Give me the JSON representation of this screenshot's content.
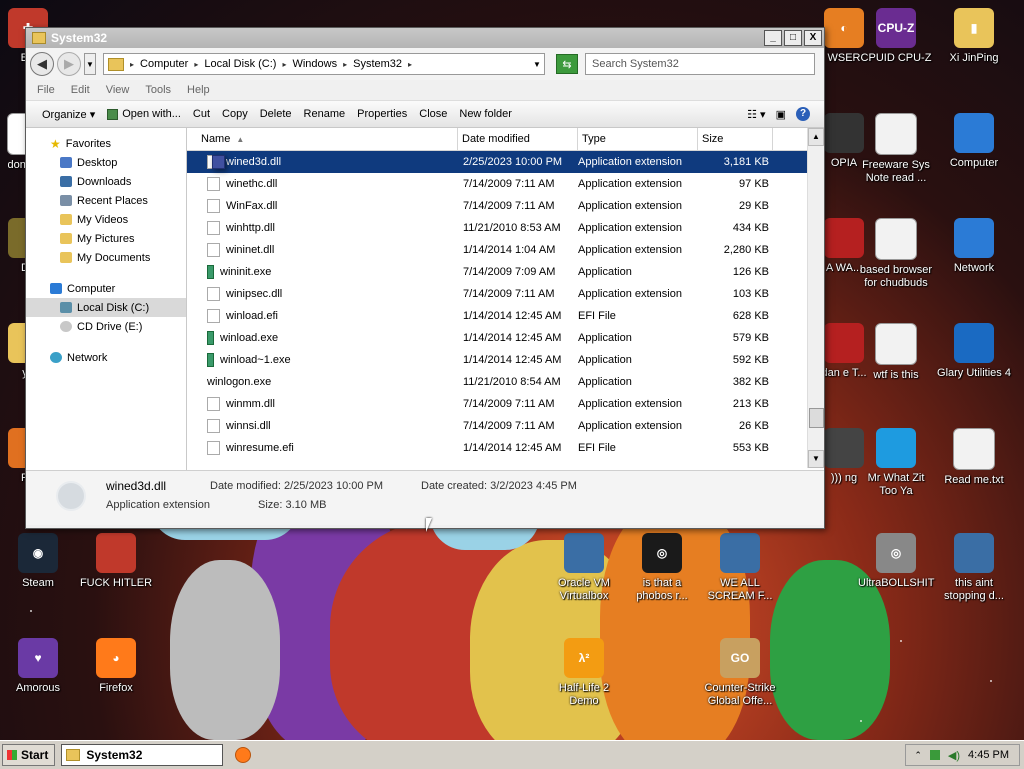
{
  "window": {
    "title": "System32",
    "controls": {
      "minimize": "_",
      "maximize": "□",
      "close": "X"
    }
  },
  "address": {
    "crumbs": [
      "Computer",
      "Local Disk (C:)",
      "Windows",
      "System32"
    ],
    "separator": "▸",
    "search_placeholder": "Search System32"
  },
  "menu": [
    "File",
    "Edit",
    "View",
    "Tools",
    "Help"
  ],
  "toolbar": {
    "organize": "Organize ▾",
    "open_with": "Open with...",
    "cut": "Cut",
    "copy": "Copy",
    "delete": "Delete",
    "rename": "Rename",
    "properties": "Properties",
    "close": "Close",
    "new_folder": "New folder",
    "help_icon": "?"
  },
  "nav": {
    "favorites_label": "Favorites",
    "favorites": [
      "Desktop",
      "Downloads",
      "Recent Places",
      "My Videos",
      "My Pictures",
      "My Documents"
    ],
    "computer_label": "Computer",
    "drives": [
      "Local Disk (C:)",
      "CD Drive (E:)"
    ],
    "network_label": "Network"
  },
  "columns": {
    "name": "Name",
    "date": "Date modified",
    "type": "Type",
    "size": "Size"
  },
  "files": [
    {
      "name": "wined3d.dll",
      "date": "2/25/2023 10:00 PM",
      "type": "Application extension",
      "size": "3,181 KB",
      "icon": "dll-icon",
      "selected": true
    },
    {
      "name": "winethc.dll",
      "date": "7/14/2009 7:11 AM",
      "type": "Application extension",
      "size": "97 KB",
      "icon": "dll-icon"
    },
    {
      "name": "WinFax.dll",
      "date": "7/14/2009 7:11 AM",
      "type": "Application extension",
      "size": "29 KB",
      "icon": "dll-icon"
    },
    {
      "name": "winhttp.dll",
      "date": "11/21/2010 8:53 AM",
      "type": "Application extension",
      "size": "434 KB",
      "icon": "dll-icon"
    },
    {
      "name": "wininet.dll",
      "date": "1/14/2014 1:04 AM",
      "type": "Application extension",
      "size": "2,280 KB",
      "icon": "dll-icon"
    },
    {
      "name": "wininit.exe",
      "date": "7/14/2009 7:09 AM",
      "type": "Application",
      "size": "126 KB",
      "icon": "exe-icon"
    },
    {
      "name": "winipsec.dll",
      "date": "7/14/2009 7:11 AM",
      "type": "Application extension",
      "size": "103 KB",
      "icon": "dll-icon"
    },
    {
      "name": "winload.efi",
      "date": "1/14/2014 12:45 AM",
      "type": "EFI File",
      "size": "628 KB",
      "icon": "file-icon"
    },
    {
      "name": "winload.exe",
      "date": "1/14/2014 12:45 AM",
      "type": "Application",
      "size": "579 KB",
      "icon": "exe-icon"
    },
    {
      "name": "winload~1.exe",
      "date": "1/14/2014 12:45 AM",
      "type": "Application",
      "size": "592 KB",
      "icon": "exe-icon"
    },
    {
      "name": "winlogon.exe",
      "date": "11/21/2010 8:54 AM",
      "type": "Application",
      "size": "382 KB",
      "icon": "winlogon-icon"
    },
    {
      "name": "winmm.dll",
      "date": "7/14/2009 7:11 AM",
      "type": "Application extension",
      "size": "213 KB",
      "icon": "dll-icon"
    },
    {
      "name": "winnsi.dll",
      "date": "7/14/2009 7:11 AM",
      "type": "Application extension",
      "size": "26 KB",
      "icon": "dll-icon"
    },
    {
      "name": "winresume.efi",
      "date": "1/14/2014 12:45 AM",
      "type": "EFI File",
      "size": "553 KB",
      "icon": "file-icon"
    }
  ],
  "details": {
    "name": "wined3d.dll",
    "type": "Application extension",
    "modified": "Date modified: 2/25/2023 10:00 PM",
    "created": "Date created: 3/2/2023 4:45 PM",
    "size": "Size: 3.10 MB"
  },
  "desktop_icons": [
    {
      "label": "BE",
      "color": "#c0392b"
    },
    {
      "label": "WSER",
      "color": "#e67e22"
    },
    {
      "label": "CPUID CPU-Z",
      "color": "#6a2c91"
    },
    {
      "label": "Xi JinPing",
      "color": "#e9c45a"
    },
    {
      "label": "don was",
      "color": "#ffffff"
    },
    {
      "label": "OPIA",
      "color": "#333333"
    },
    {
      "label": "Freeware Sys Note read ...",
      "color": "#f2f2f2"
    },
    {
      "label": "Computer",
      "color": "#2b7bd6"
    },
    {
      "label": "Do",
      "color": "#7a6b2a"
    },
    {
      "label": "A WA...",
      "color": "#b52020"
    },
    {
      "label": "based browser for chudbuds",
      "color": "#f2f2f2"
    },
    {
      "label": "Network",
      "color": "#2b7bd6"
    },
    {
      "label": "yo",
      "color": "#e9c45a"
    },
    {
      "label": "dan e T...",
      "color": "#b52020"
    },
    {
      "label": "wtf is this",
      "color": "#f2f2f2"
    },
    {
      "label": "Glary Utilities 4",
      "color": "#1a6ac2"
    },
    {
      "label": "Re",
      "color": "#e07020"
    },
    {
      "label": "))) ng",
      "color": "#444444"
    },
    {
      "label": "Mr What Zit Too Ya",
      "color": "#1e9be0"
    },
    {
      "label": "Read me.txt",
      "color": "#f2f2f2"
    },
    {
      "label": "Steam",
      "color": "#1b2838"
    },
    {
      "label": "FUCK HITLER",
      "color": "#c0392b"
    },
    {
      "label": "Oracle VM Virtualbox",
      "color": "#3a6ea5"
    },
    {
      "label": "is that a phobos r...",
      "color": "#1a1a1a"
    },
    {
      "label": "WE ALL SCREAM F...",
      "color": "#3a6ea5"
    },
    {
      "label": "UltraBOLLSHIT",
      "color": "#888888"
    },
    {
      "label": "this aint stopping d...",
      "color": "#3a6ea5"
    },
    {
      "label": "Amorous",
      "color": "#6a3aa5"
    },
    {
      "label": "Firefox",
      "color": "#ff7a1a"
    },
    {
      "label": "Half-Life 2 Demo",
      "color": "#f39c12"
    },
    {
      "label": "Counter-Strike Global Offe...",
      "color": "#c8a060"
    }
  ],
  "icon_glyphs": {
    "BE": "✚",
    "WSER": "◐",
    "CPUID CPU-Z": "CPU-Z",
    "Xi JinPing": "▮",
    "Steam": "◉",
    "Firefox": "◕",
    "Half-Life 2 Demo": "λ²",
    "Counter-Strike Global Offe...": "GO",
    "is that a phobos r...": "◎",
    "UltraBOLLSHIT": "◎",
    "Amorous": "♥"
  },
  "taskbar": {
    "start": "Start",
    "task_label": "System32",
    "clock": "4:45 PM"
  }
}
